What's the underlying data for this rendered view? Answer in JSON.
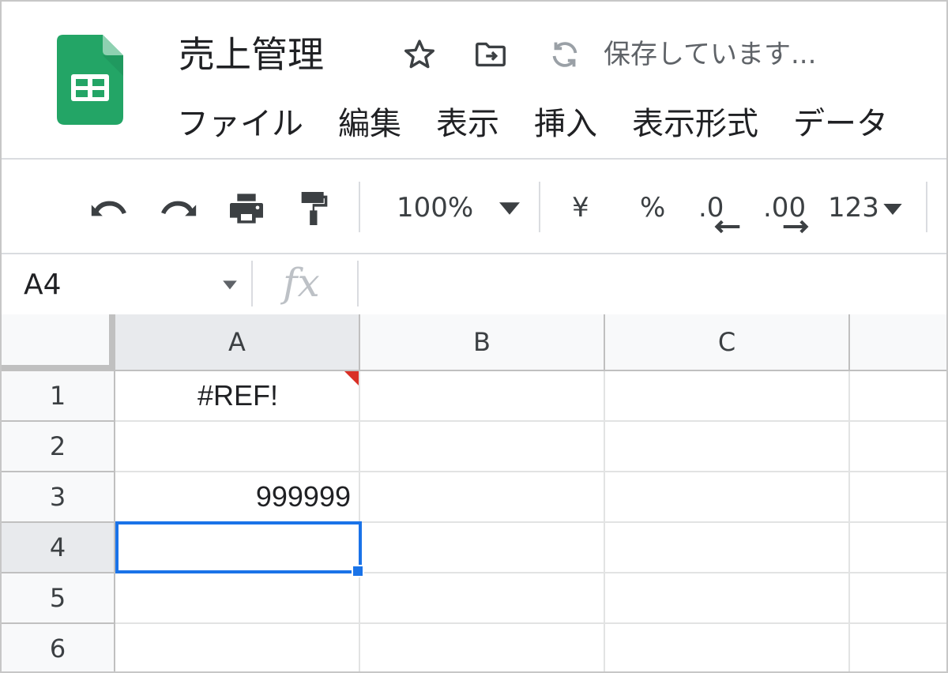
{
  "document": {
    "title": "売上管理",
    "save_status": "保存しています..."
  },
  "icons": {
    "app_logo": "google-sheets-logo",
    "star": "star-icon",
    "move": "folder-move-icon",
    "sync": "sync-icon"
  },
  "menu": {
    "items": [
      "ファイル",
      "編集",
      "表示",
      "挿入",
      "表示形式",
      "データ"
    ]
  },
  "toolbar": {
    "zoom": "100%",
    "currency": "¥",
    "percent": "%",
    "decrease_decimal": ".0",
    "increase_decimal": ".00",
    "more_formats": "123"
  },
  "formula_bar": {
    "name_box": "A4",
    "fx_label": "fx",
    "value": ""
  },
  "sheet": {
    "columns": [
      "A",
      "B",
      "C"
    ],
    "rows": [
      "1",
      "2",
      "3",
      "4",
      "5",
      "6"
    ],
    "active_cell": "A4",
    "cells": {
      "A1": "#REF!",
      "A3": "999999"
    }
  },
  "colors": {
    "sheets_green": "#23a566",
    "selection_blue": "#1a73e8",
    "error_red": "#d93025"
  }
}
